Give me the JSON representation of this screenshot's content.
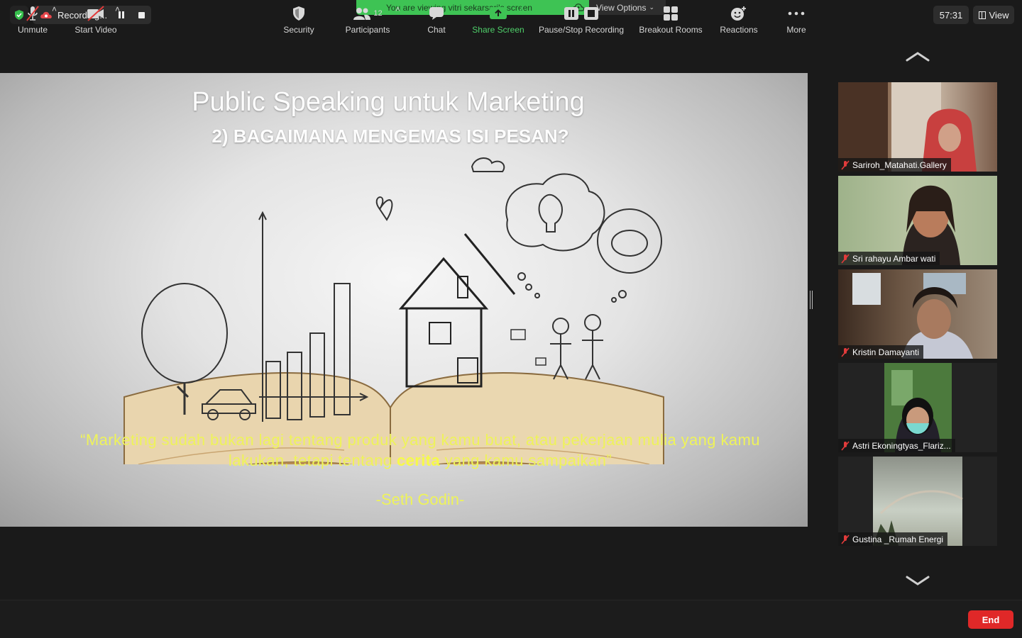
{
  "top_bar": {
    "recording_label": "Recording...",
    "viewing_banner": "You are viewing vitri sekarsari's screen",
    "view_options_label": "View Options",
    "timer": "57:31",
    "view_label": "View"
  },
  "slide": {
    "title": "Public Speaking untuk Marketing",
    "subtitle": "2) BAGAIMANA MENGEMAS ISI PESAN?",
    "quote_part1": "“Marketing sudah bukan lagi tentang produk yang kamu buat, atau pekerjaan mulia yang kamu lakukan, tetapi tentang ",
    "quote_bold": "cerita",
    "quote_part2": " yang kamu sampaikan”",
    "author": "-Seth Godin-"
  },
  "participants": [
    {
      "name": "Sariroh_Matahati.Gallery",
      "muted": true
    },
    {
      "name": "Sri rahayu Ambar wati",
      "muted": true
    },
    {
      "name": "Kristin Damayanti",
      "muted": true
    },
    {
      "name": "Astri Ekoningtyas_Flariz...",
      "muted": true
    },
    {
      "name": "Gustina _Rumah Energi",
      "muted": true
    }
  ],
  "toolbar": {
    "unmute": "Unmute",
    "start_video": "Start Video",
    "security": "Security",
    "participants": "Participants",
    "participants_count": "12",
    "chat": "Chat",
    "share_screen": "Share Screen",
    "pause_stop_recording": "Pause/Stop Recording",
    "breakout_rooms": "Breakout Rooms",
    "reactions": "Reactions",
    "more": "More",
    "end": "End"
  },
  "colors": {
    "share_green": "#3ec354",
    "end_red": "#e02828",
    "quote_yellow": "#eef35a",
    "mute_red": "#e23b3b"
  }
}
